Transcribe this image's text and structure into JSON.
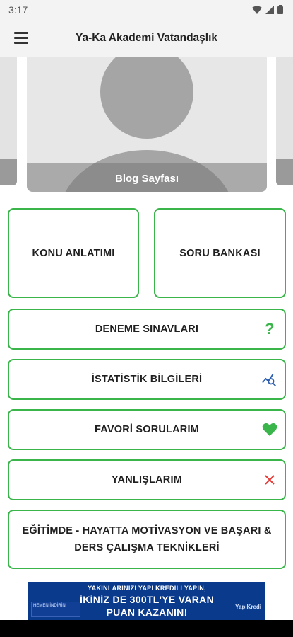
{
  "status_bar": {
    "time": "3:17"
  },
  "app_bar": {
    "title": "Ya-Ka Akademi Vatandaşlık"
  },
  "carousel": {
    "caption": "Blog Sayfası"
  },
  "tiles": {
    "konu": "KONU ANLATIMI",
    "soru": "SORU BANKASI",
    "deneme": "DENEME SINAVLARI",
    "istatistik": "İSTATİSTİK BİLGİLERİ",
    "favori": "FAVORİ SORULARIM",
    "yanlis": "YANLIŞLARIM",
    "egitim": "EĞİTİMDE - HAYATTA MOTİVASYON VE BAŞARI & DERS ÇALIŞMA TEKNİKLERİ"
  },
  "ad": {
    "line1": "YAKINLARINIZI YAPI KREDİLİ YAPIN,",
    "line2": "İKİNİZ DE 300TL'YE VARAN",
    "line3": "PUAN KAZANIN!",
    "mini": "HEMEN İNDİRİN!",
    "brand": "YapıKredi"
  },
  "colors": {
    "accent": "#39b54a",
    "error": "#e53935",
    "ad_bg": "#0a3a8c"
  }
}
